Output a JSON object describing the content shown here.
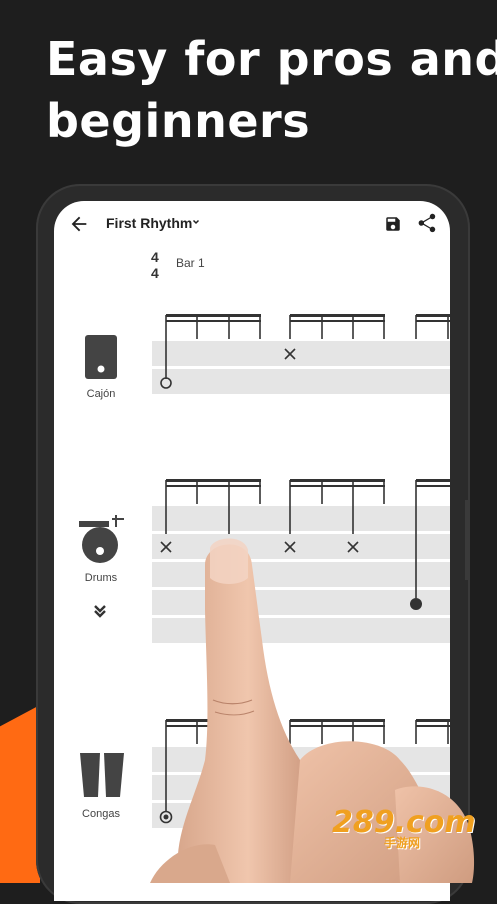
{
  "headline": {
    "line1": "Easy for pros and",
    "line2": "beginners"
  },
  "appbar": {
    "back_icon": "arrow-left-icon",
    "title": "First Rhythm",
    "dropdown_icon": "chevron-down-icon",
    "save_icon": "save-icon",
    "share_icon": "share-icon"
  },
  "score": {
    "time_signature_top": "4",
    "time_signature_bottom": "4",
    "bar_label": "Bar 1"
  },
  "instruments": [
    {
      "name": "Cajón",
      "icon": "cajon-icon"
    },
    {
      "name": "Drums",
      "icon": "drum-kit-icon",
      "expand_icon": "double-chevron-down-icon"
    },
    {
      "name": "Congas",
      "icon": "congas-icon"
    }
  ],
  "watermark": {
    "text": "289.com",
    "sub": "手游网"
  },
  "colors": {
    "background": "#1e1e1e",
    "accent": "#ff6a13",
    "lane": "#e5e5e5",
    "note": "#333333"
  }
}
